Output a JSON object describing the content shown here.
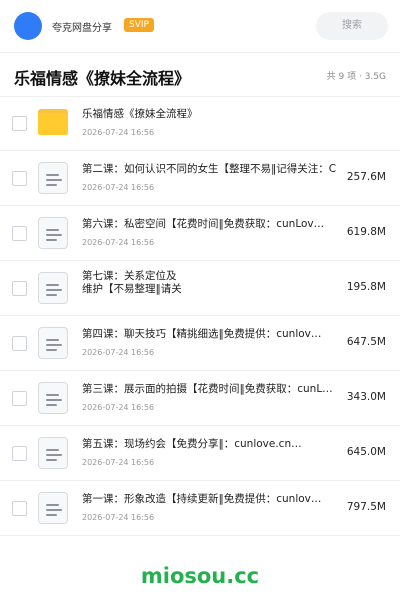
{
  "header": {
    "site_name": "夸克网盘分享",
    "badge": "SVIP",
    "search_label": "搜索",
    "avatar_color": "#2f7cf6"
  },
  "folder": {
    "title": "乐福情感《撩妹全流程》",
    "meta": "共 9 项 · 3.5G"
  },
  "files": [
    {
      "name": "乐福情感《撩妹全流程》",
      "date": "2026-07-24 16:56",
      "size": "",
      "type": "folder-icon"
    },
    {
      "name": "第二课：如何认识不同的女生【整理不易‖记得关注：C",
      "date": "2026-07-24 16:56",
      "size": "257.6M",
      "type": "video-file-icon"
    },
    {
      "name": "第六课：私密空间【花费时间‖免费获取：cunLov…",
      "date": "2026-07-24 16:56",
      "size": "619.8M",
      "type": "video-file-icon"
    },
    {
      "name": "第七课：关系定位及维护【不易整理‖请关注：cun…",
      "date": "",
      "size": "195.8M",
      "type": "video-file-icon"
    },
    {
      "name": "第四课：聊天技巧【精挑细选‖免费提供：cunlov…",
      "date": "2026-07-24 16:56",
      "size": "647.5M",
      "type": "video-file-icon"
    },
    {
      "name": "第三课：展示面的拍摄【花费时间‖免费获取：cunL…",
      "date": "2026-07-24 16:56",
      "size": "343.0M",
      "type": "video-file-icon"
    },
    {
      "name": "第五课：现场约会【免费分享‖：cunlove.cn…",
      "date": "2026-07-24 16:56",
      "size": "645.0M",
      "type": "video-file-icon"
    },
    {
      "name": "第一课：形象改造【持续更新‖免费提供：cunlov…",
      "date": "2026-07-24 16:56",
      "size": "797.5M",
      "type": "video-file-icon"
    }
  ],
  "watermark": "miosou.cc",
  "colors": {
    "badge": "#f5a623",
    "folder": "#ffcb2f",
    "watermark": "#22b14c"
  }
}
